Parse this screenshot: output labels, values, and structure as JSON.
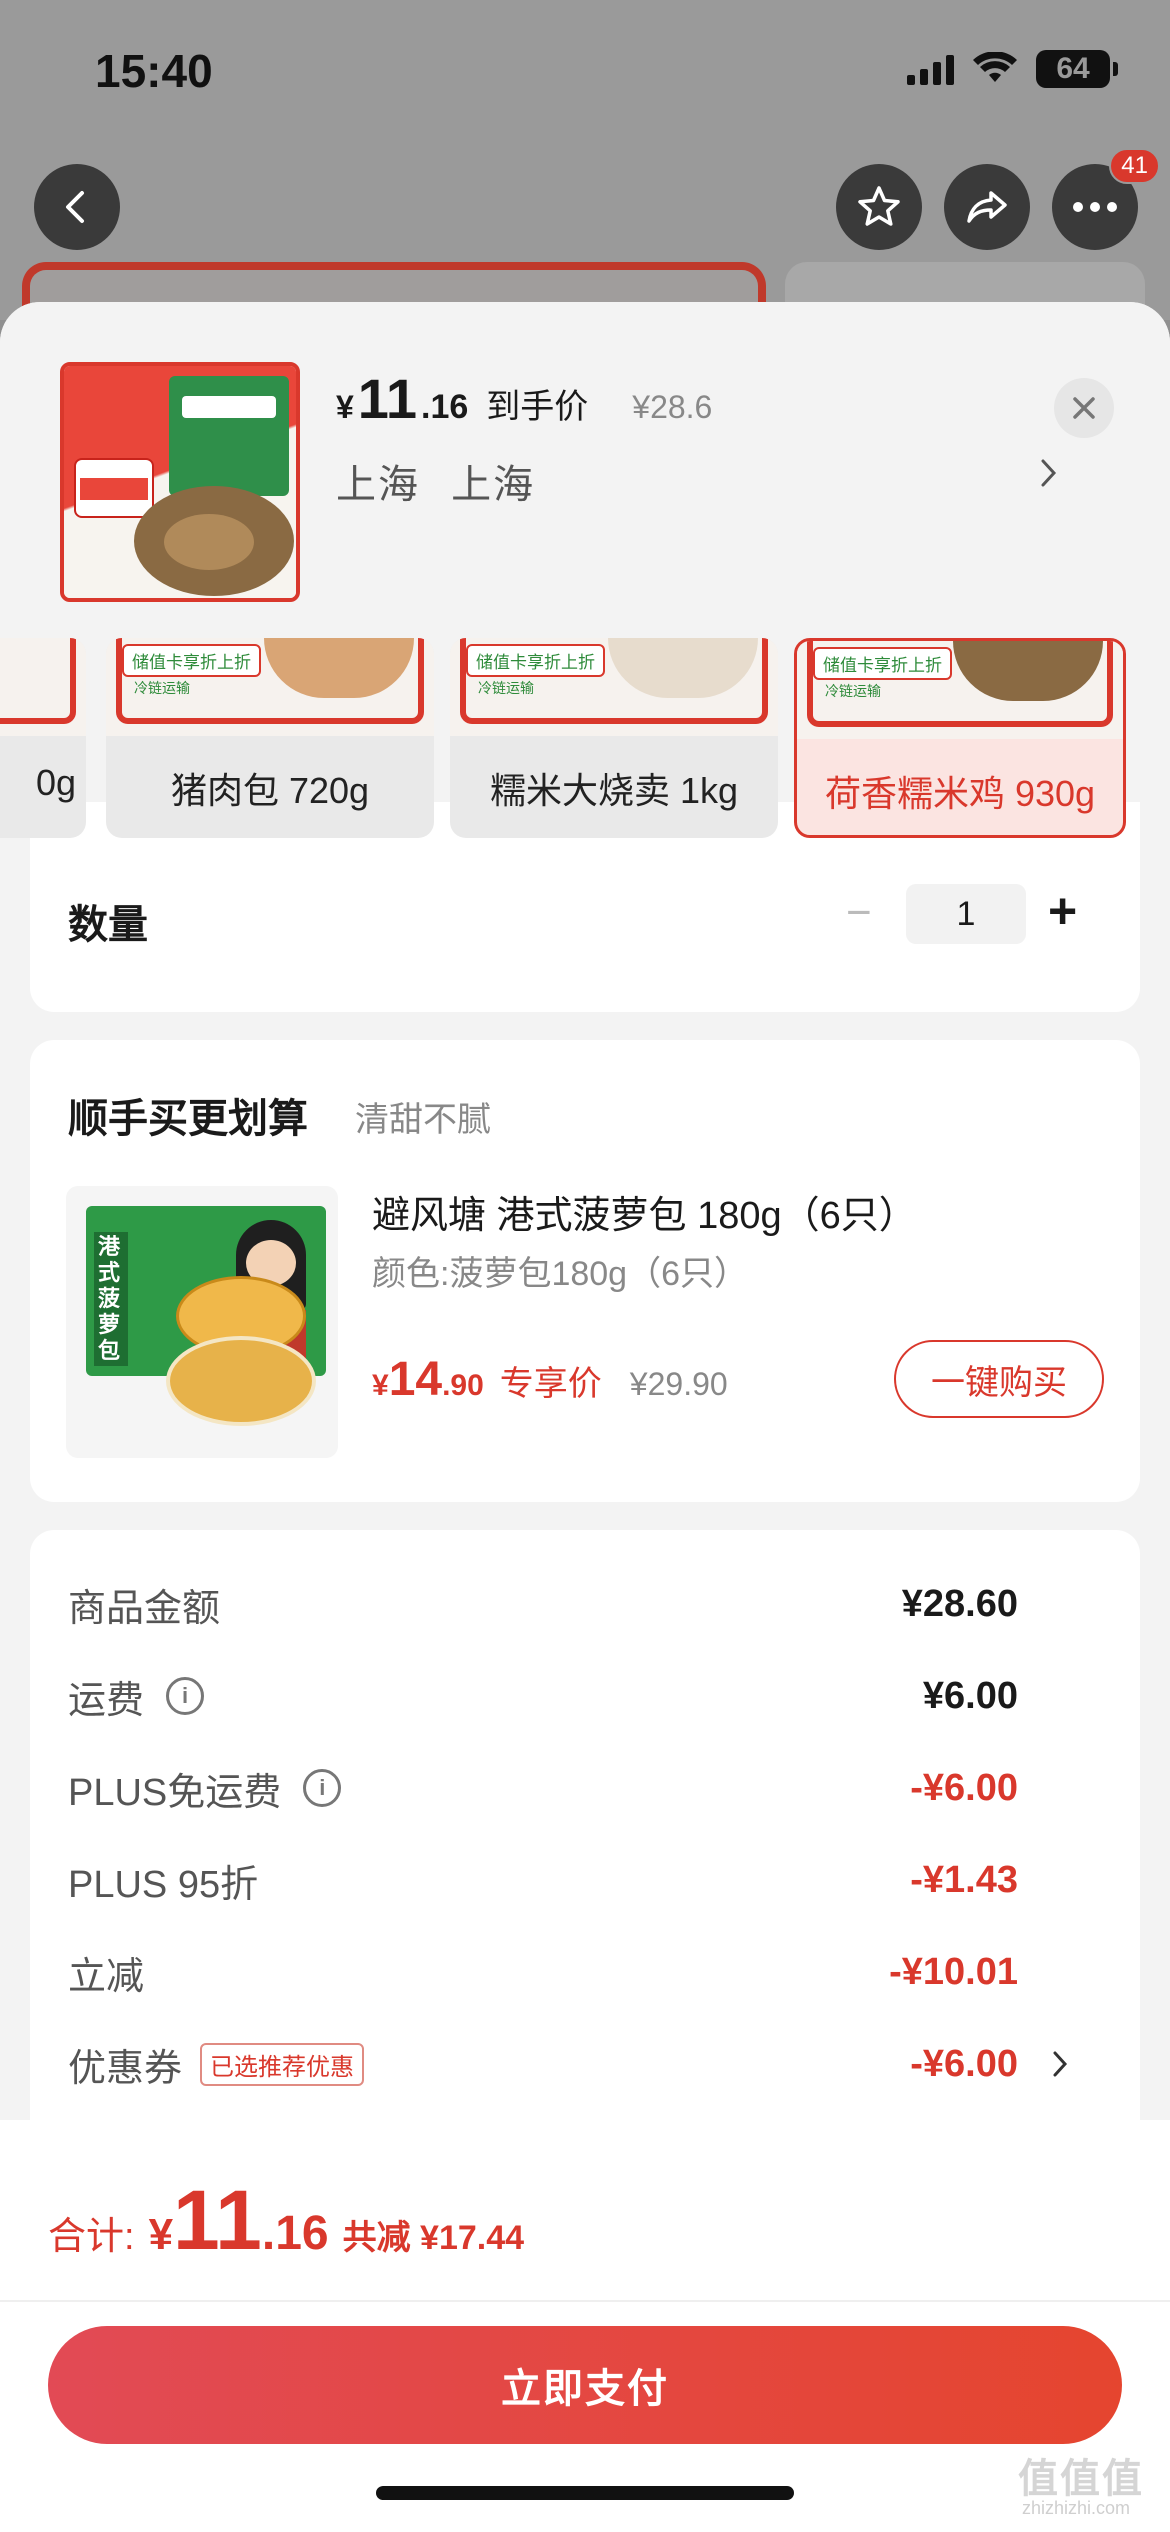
{
  "status": {
    "time": "15:40",
    "battery": "64"
  },
  "top_actions": {
    "more_badge": "41"
  },
  "product": {
    "price_yen": "¥",
    "price_int": "11",
    "price_dec": ".16",
    "price_tag": "到手价",
    "price_orig": "¥28.6",
    "location": "上海 上海"
  },
  "variants": [
    {
      "label": "0g"
    },
    {
      "label": "猪肉包 720g"
    },
    {
      "label": "糯米大烧卖 1kg"
    },
    {
      "label": "荷香糯米鸡 930g"
    }
  ],
  "variant_tag": "储值卡享折上折",
  "variant_tag2": "冷链运输",
  "quantity": {
    "label": "数量",
    "value": "1",
    "minus": "−",
    "plus": "+"
  },
  "addon": {
    "title": "顺手买更划算",
    "subtitle": "清甜不腻",
    "name": "避风塘 港式菠萝包 180g（6只）",
    "spec": "颜色:菠萝包180g（6只）",
    "price_yen": "¥",
    "price_int": "14",
    "price_dec": ".90",
    "price_tag": "专享价",
    "price_orig": "¥29.90",
    "button": "一键购买",
    "pack_text": "港式菠萝包"
  },
  "summary": [
    {
      "label": "商品金额",
      "value": "¥28.60",
      "red": false,
      "info": false
    },
    {
      "label": "运费",
      "value": "¥6.00",
      "red": false,
      "info": true
    },
    {
      "label": "PLUS免运费",
      "value": "-¥6.00",
      "red": true,
      "info": true
    },
    {
      "label": "PLUS 95折",
      "value": "-¥1.43",
      "red": true,
      "info": false
    },
    {
      "label": "立减",
      "value": "-¥10.01",
      "red": true,
      "info": false
    },
    {
      "label": "优惠券",
      "value": "-¥6.00",
      "red": true,
      "info": false,
      "tag": "已选推荐优惠"
    }
  ],
  "total": {
    "label": "合计:",
    "yen": "¥",
    "int": "11",
    "dec": ".16",
    "saved": "共减 ¥17.44"
  },
  "pay_button": "立即支付",
  "watermark": "值值值",
  "watermark_sub": "zhizhizhi.com",
  "colors": {
    "accent": "#d9382c",
    "pay_start": "#e24a55",
    "pay_end": "#e5452f"
  }
}
